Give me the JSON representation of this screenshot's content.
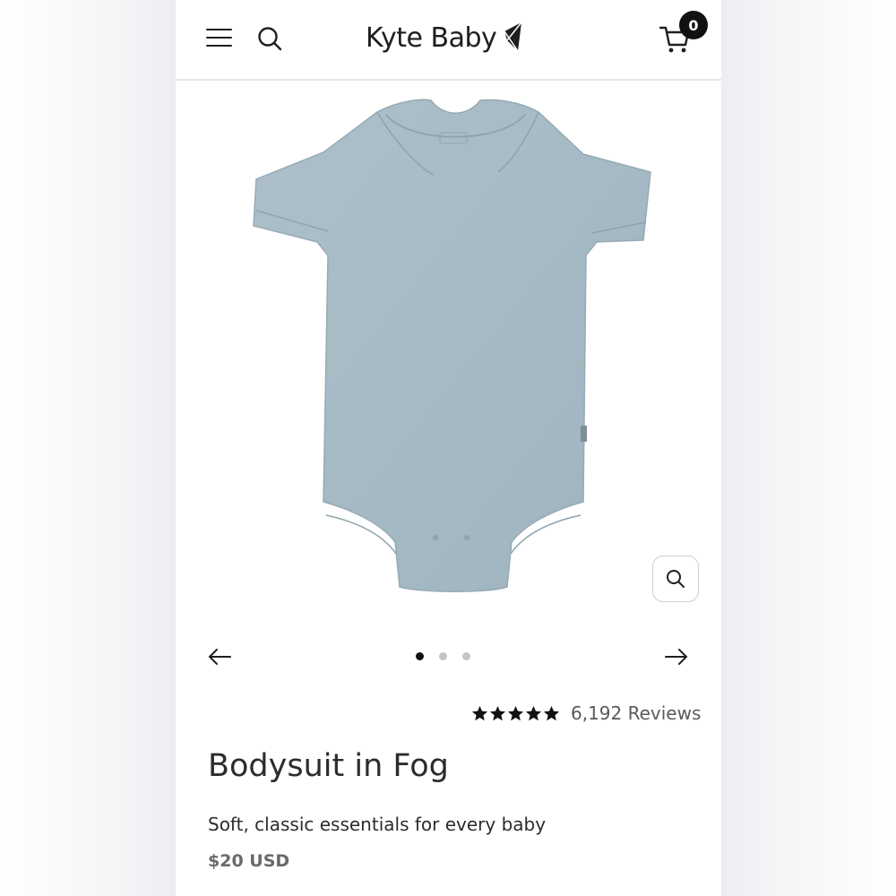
{
  "header": {
    "brand": "Kyte Baby",
    "cart_count": "0",
    "icons": {
      "menu": "hamburger-menu-icon",
      "search": "search-icon",
      "logo_mark": "kite-logo-icon",
      "cart": "shopping-cart-icon"
    }
  },
  "product": {
    "image_subject": "short-sleeve bodysuit",
    "image_color": "#a9bdc7",
    "title": "Bodysuit in Fog",
    "subtitle": "Soft, classic essentials for every baby",
    "price": "$20 USD",
    "rating": {
      "stars": 5,
      "max_stars": 5,
      "reviews": "6,192 Reviews"
    }
  },
  "carousel": {
    "slide_count": 3,
    "active_index": 0,
    "icons": {
      "prev": "arrow-left-icon",
      "next": "arrow-right-icon",
      "zoom": "zoom-search-icon"
    }
  },
  "colors": {
    "accent": "#111111",
    "text": "#2c2c2c",
    "muted": "#6a6a6a",
    "dot_inactive": "#c4c4c4"
  }
}
